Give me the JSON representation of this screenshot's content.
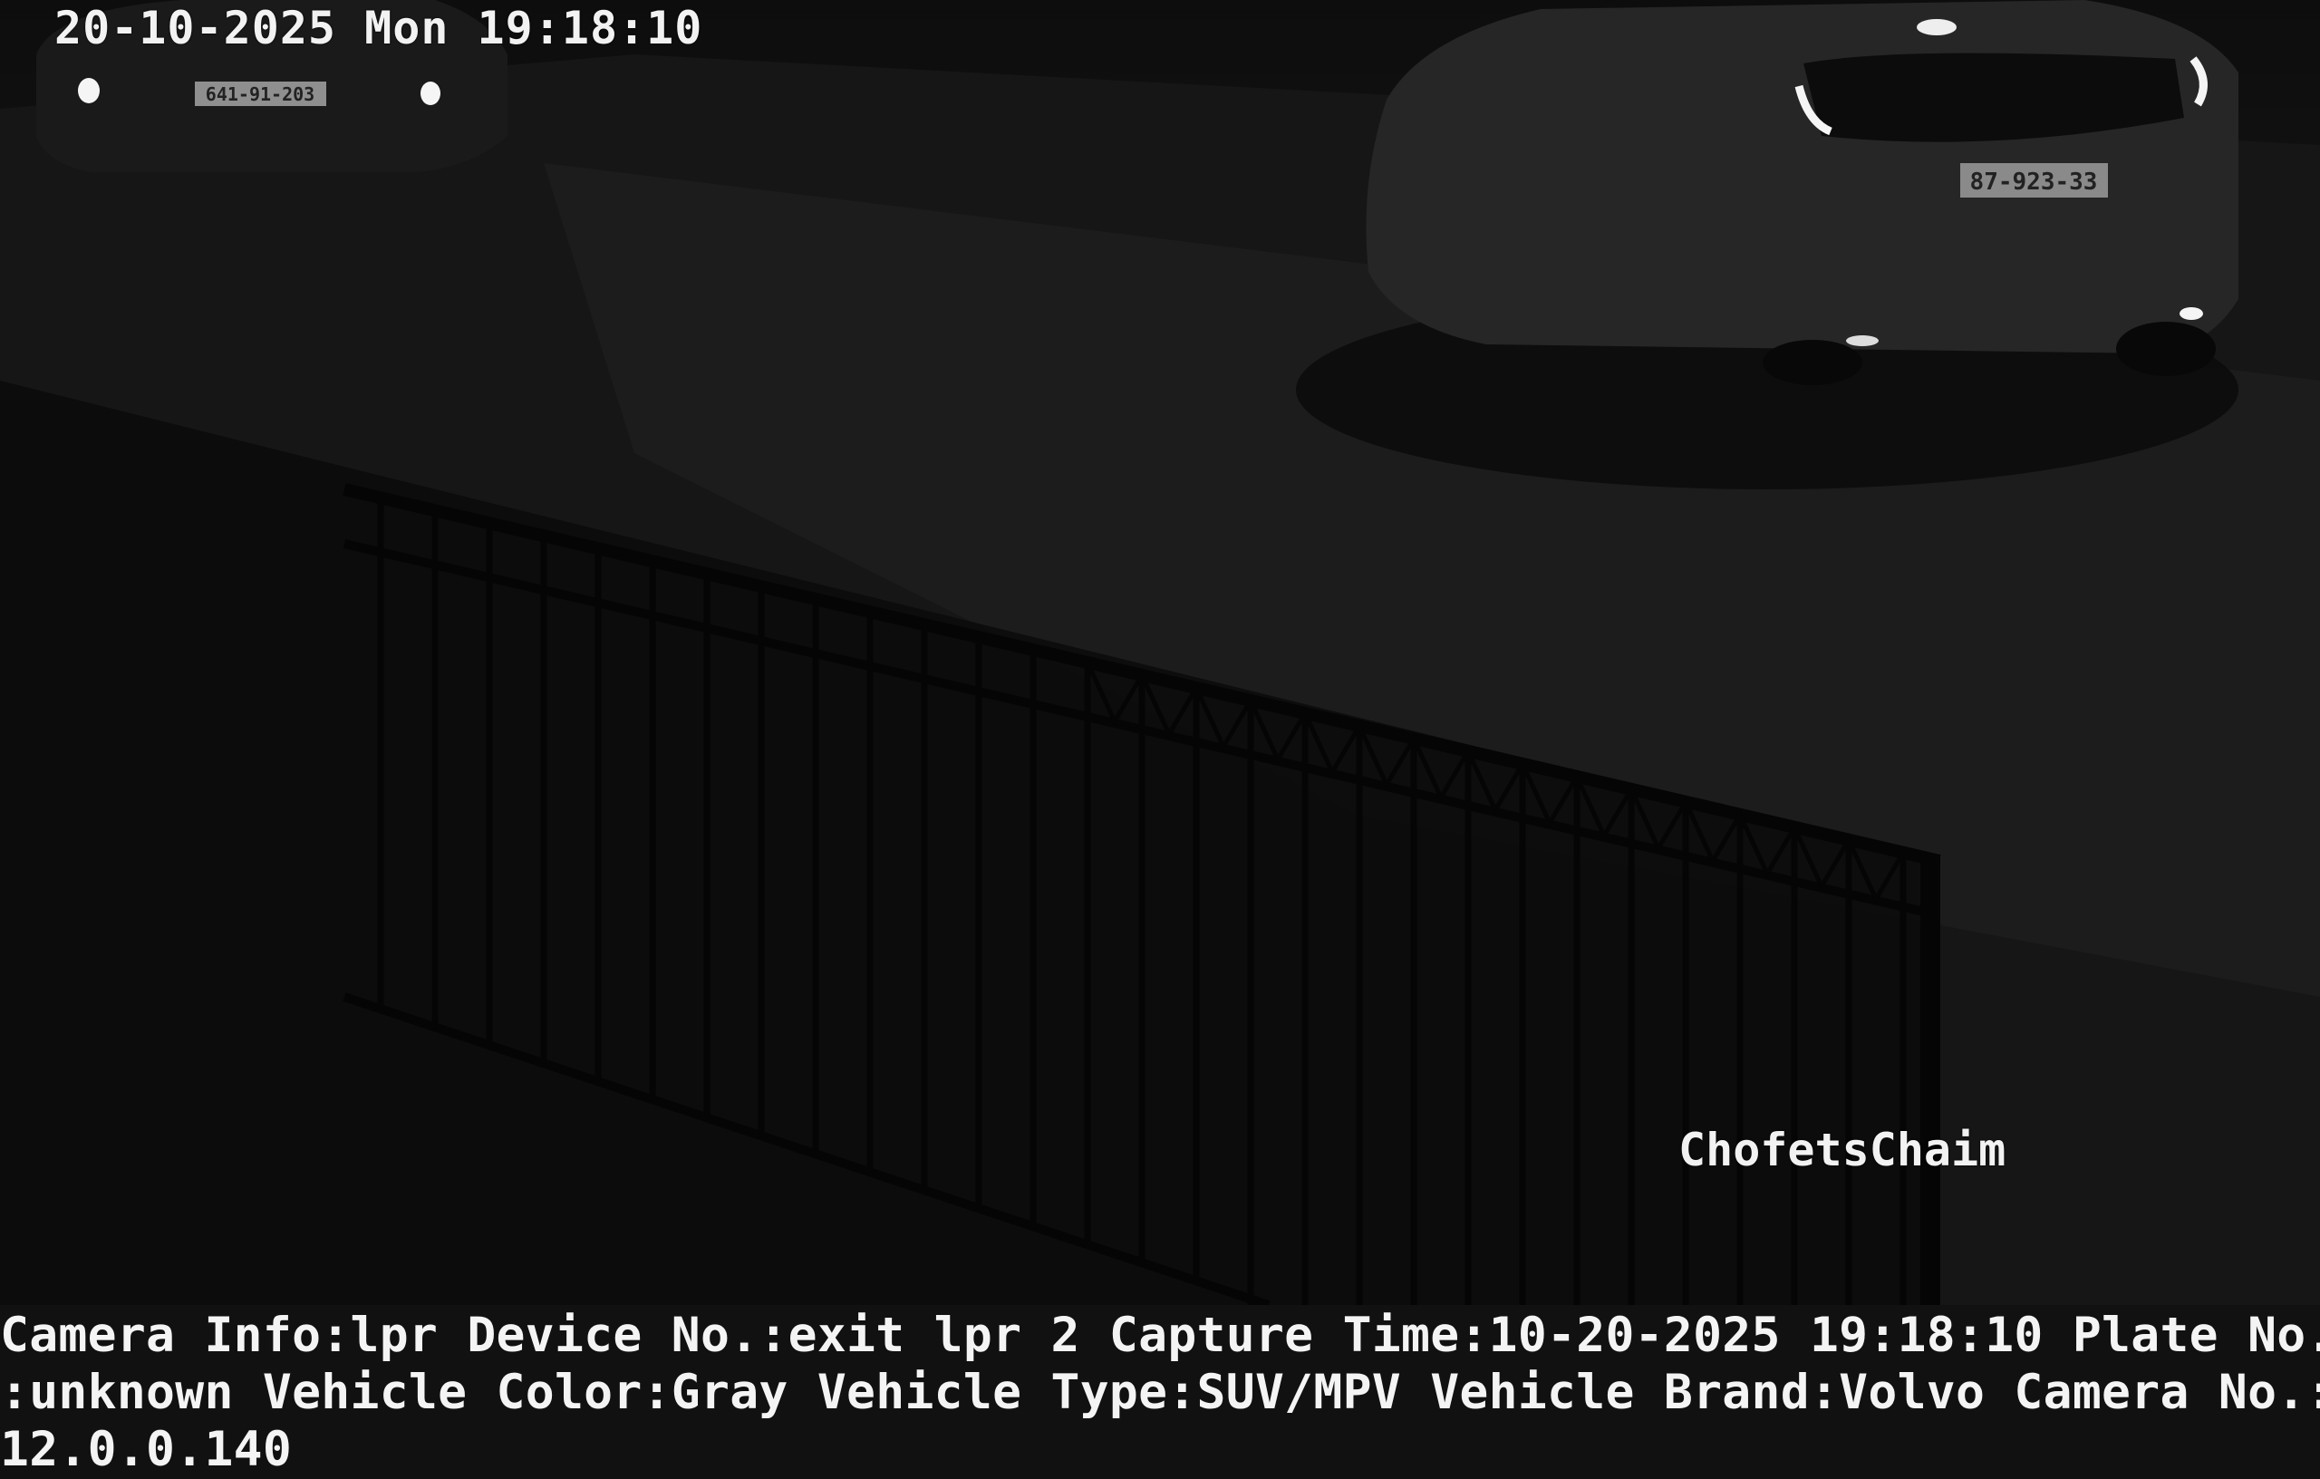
{
  "osd": {
    "timestamp": "20-10-2025 Mon 19:18:10",
    "site_name": "ChofetsChaim"
  },
  "scene": {
    "left_vehicle_plate": "641-91-203",
    "right_vehicle_plate": "87-923-33"
  },
  "capture_info": {
    "line1": "Camera Info:lpr Device No.:exit lpr 2 Capture Time:10-20-2025 19:18:10 Plate No.",
    "line2": ":unknown Vehicle Color:Gray Vehicle Type:SUV/MPV Vehicle Brand:Volvo Camera No.:",
    "line3": "12.0.0.140"
  }
}
